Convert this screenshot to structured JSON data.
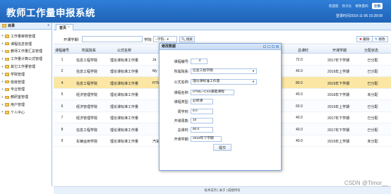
{
  "header": {
    "title": "教师工作量申报系统",
    "role_label": "欢迎您",
    "user": "教务处",
    "change_pwd": "修改密码",
    "logout": "注销",
    "login_time": "登录时间2019-11-06 15:28:08"
  },
  "sidebar": {
    "title": "目录",
    "items": [
      {
        "label": "工作量审核管理",
        "expandable": true
      },
      {
        "label": "课程信息管理",
        "expandable": true
      },
      {
        "label": "教师工作量汇总管理",
        "expandable": true
      },
      {
        "label": "工作量计算公式管理",
        "expandable": true
      },
      {
        "label": "其它工作量管理",
        "expandable": true
      },
      {
        "label": "学院管理",
        "expandable": true
      },
      {
        "label": "班级管理",
        "expandable": true
      },
      {
        "label": "专业管理",
        "expandable": true
      },
      {
        "label": "教研室管理",
        "expandable": true
      },
      {
        "label": "用户管理",
        "expandable": true
      },
      {
        "label": "个人中心",
        "expandable": true
      }
    ]
  },
  "tabs": [
    {
      "label": "首页"
    }
  ],
  "toolbar": {
    "term_label": "开课学期:",
    "college_label": "学院:",
    "college_select": "--学院--",
    "search_label": "搜索",
    "delete_label": "删除",
    "edit_label": "修改"
  },
  "grid": {
    "headers": {
      "no": "课程编号",
      "college": "所属院系",
      "formula": "公式名称",
      "total": "总课时",
      "term": "开课学期",
      "status": "分配状态"
    },
    "rows": [
      {
        "no": "1",
        "college": "信息工程学院",
        "formula": "理论课标准工作量",
        "clip": "Ja",
        "total": "72.0",
        "term": "2017年下学期",
        "status": "已分配",
        "state": "normal"
      },
      {
        "no": "2",
        "college": "信息工程学院",
        "formula": "理论课标准工作量",
        "clip": "My",
        "total": "40.0",
        "term": "2019年上学期",
        "status": "已分配",
        "state": "alt"
      },
      {
        "no": "4",
        "college": "信息工程学院",
        "formula": "理论课标准工作量",
        "clip": "HTML",
        "total": "80.0",
        "term": "2019年下学期",
        "status": "已分配",
        "state": "selected"
      },
      {
        "no": "5",
        "college": "经济管理学院",
        "formula": "理论课标准工作量",
        "clip": "",
        "total": "40.0",
        "term": "2018年下学期",
        "status": "未分配",
        "state": "normal"
      },
      {
        "no": "6",
        "college": "经济管理学院",
        "formula": "理论课标准工作量",
        "clip": "",
        "total": "60.0",
        "term": "2019年上学期",
        "status": "已分配",
        "state": "alt"
      },
      {
        "no": "7",
        "college": "经济管理学院",
        "formula": "理论课标准工作量",
        "clip": "",
        "total": "40.0",
        "term": "2017年下学期",
        "status": "已分配",
        "state": "normal"
      },
      {
        "no": "8",
        "college": "信息工程学院",
        "formula": "理论课标准工作量",
        "clip": "",
        "total": "40.0",
        "term": "2017年下学期",
        "status": "已分配",
        "state": "alt"
      },
      {
        "no": "9",
        "college": "车辆运用学院",
        "formula": "理论课标准工作量",
        "clip": "汽车",
        "total": "40.0",
        "term": "2019年上学期",
        "status": "未分配",
        "state": "normal"
      }
    ]
  },
  "dialog": {
    "title": "修改数据",
    "fields": {
      "course_no": {
        "label": "课程编号:",
        "value": "4"
      },
      "college": {
        "label": "所属院系:",
        "value": "信息工程学院"
      },
      "formula": {
        "label": "公式名称:",
        "value": "理论课标准工作量"
      },
      "course_name": {
        "label": "课程名称:",
        "value": "HTML+CSS基础课程"
      },
      "course_type": {
        "label": "课程类型:",
        "value": "必修课"
      },
      "weekly_hours": {
        "label": "周学时:",
        "value": "8.0"
      },
      "weeks": {
        "label": "开课周数:",
        "value": "10"
      },
      "total": {
        "label": "总课时:",
        "value": "80.0"
      },
      "term": {
        "label": "开课学期:",
        "value": "2019年下学期"
      }
    },
    "submit": "提交"
  },
  "footer": "技术支持 | 关于 | 成绩所有",
  "watermark": "CSDN @Timor__",
  "colors": {
    "header": "#1f63b6",
    "selected_row": "#fbe6a3",
    "border": "#9ec0e8"
  }
}
